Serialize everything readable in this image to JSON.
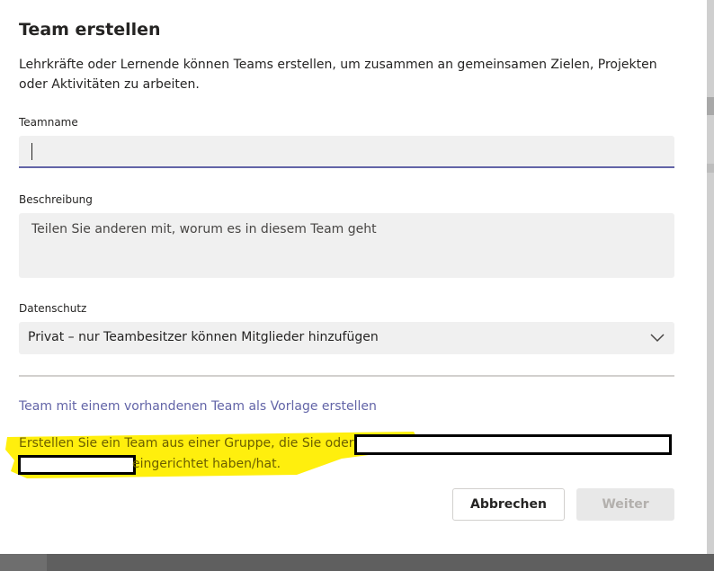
{
  "dialog": {
    "title": "Team erstellen",
    "subtitle": "Lehrkräfte oder Lernende können Teams erstellen, um zusammen an gemeinsamen Zielen, Projekten oder Aktivitäten zu arbeiten."
  },
  "form": {
    "teamname_label": "Teamname",
    "teamname_value": "",
    "description_label": "Beschreibung",
    "description_placeholder": "Teilen Sie anderen mit, worum es in diesem Team geht",
    "privacy_label": "Datenschutz",
    "privacy_value": "Privat – nur Teambesitzer können Mitglieder hinzufügen"
  },
  "template_link": "Team mit einem vorhandenen Team als Vorlage erstellen",
  "group_info": {
    "part1": "Erstellen Sie ein Team aus einer Gruppe, die Sie oder",
    "part2": "eingerichtet haben/hat."
  },
  "buttons": {
    "cancel": "Abbrechen",
    "next": "Weiter"
  },
  "colors": {
    "accent": "#6264a7",
    "highlight": "#ffee00",
    "field_bg": "#f0f0f0"
  },
  "icons": {
    "dropdown": "chevron-down-icon"
  }
}
